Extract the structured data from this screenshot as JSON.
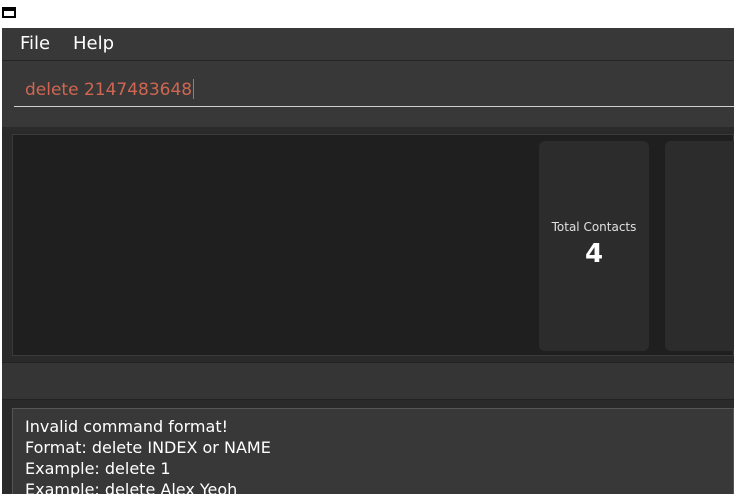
{
  "window": {
    "icon": "window-icon"
  },
  "menu": {
    "file": "File",
    "help": "Help"
  },
  "command": {
    "value": "delete 2147483648"
  },
  "dashboard": {
    "cards": [
      {
        "label": "Total Contacts",
        "value": "4"
      }
    ]
  },
  "result": {
    "lines": [
      "Invalid command format!",
      "Format: delete INDEX or NAME",
      "Example: delete 1",
      "Example: delete Alex Yeoh"
    ]
  }
}
